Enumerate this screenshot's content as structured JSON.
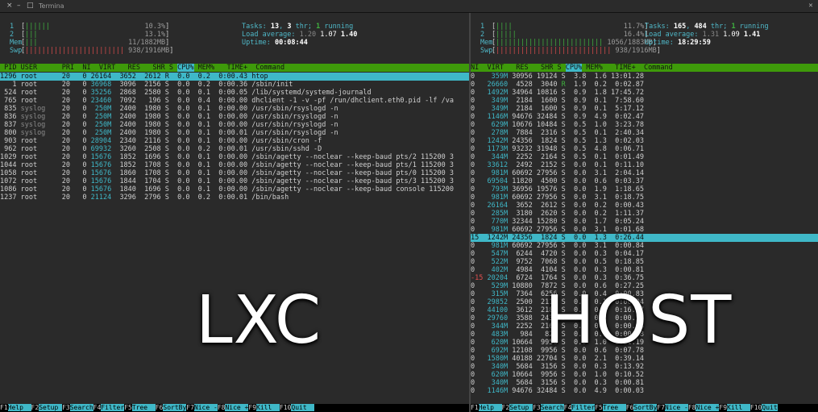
{
  "window": {
    "title": "Termina",
    "close_glyph": "×",
    "minimize_glyph": "–",
    "maximize_glyph": "□",
    "right_glyph": "✕"
  },
  "colors": {
    "accent_cyan": "#3fb8c8",
    "header_green": "#3e9a0a",
    "bar_green": "#3fb13f",
    "bar_red": "#d84a4a"
  },
  "left": {
    "meters": [
      {
        "label": "1",
        "bars": "||||||",
        "value": "10.3%"
      },
      {
        "label": "2",
        "bars": "|||",
        "value": "13.1%"
      },
      {
        "label": "Mem",
        "bars": "|||",
        "value": "11/1882MB"
      },
      {
        "label": "Swp",
        "bars": "||||||||||||||||||||||||",
        "value": "938/1916MB"
      }
    ],
    "tasks_label": "Tasks: ",
    "tasks": "13",
    "tasks_sep": ", ",
    "thr": "3",
    "thr_label": " thr; ",
    "running": "1",
    "running_label": " running",
    "load_label": "Load average: ",
    "load1": "1.20",
    "load5": "1.07",
    "load15": "1.40",
    "uptime_label": "Uptime: ",
    "uptime": "00:08:44",
    "header": {
      "pre": " PID USER      PRI  NI  VIRT   RES   SHR S ",
      "sel": "CPU%",
      "post": " MEM%   TIME+  Command"
    },
    "rows": [
      {
        "pid": "1296",
        "user": "root",
        "pri": "20",
        "ni": "0",
        "virt": "26164",
        "res": "3652",
        "shr": "2612",
        "s": "R",
        "cpu": "0.0",
        "mem": "0.2",
        "time": "0:00.43",
        "cmd": "htop"
      },
      {
        "pid": "1",
        "user": "root",
        "pri": "20",
        "ni": "0",
        "virt": "36968",
        "res": "3096",
        "shr": "2156",
        "s": "S",
        "cpu": "0.0",
        "mem": "0.2",
        "time": "0:00.36",
        "cmd": "/sbin/init"
      },
      {
        "pid": "524",
        "user": "root",
        "pri": "20",
        "ni": "0",
        "virt": "35256",
        "res": "2868",
        "shr": "2580",
        "s": "S",
        "cpu": "0.0",
        "mem": "0.1",
        "time": "0:00.05",
        "cmd": "/lib/systemd/systemd-journald"
      },
      {
        "pid": "765",
        "user": "root",
        "pri": "20",
        "ni": "0",
        "virt": "23460",
        "res": "7092",
        "shr": "196",
        "s": "S",
        "cpu": "0.0",
        "mem": "0.4",
        "time": "0:00.00",
        "cmd": "dhclient -1 -v -pf /run/dhclient.eth0.pid -lf /va"
      },
      {
        "pid": "835",
        "user": "syslog",
        "pri": "20",
        "ni": "0",
        "virt": "250M",
        "res": "2400",
        "shr": "1980",
        "s": "S",
        "cpu": "0.0",
        "mem": "0.1",
        "time": "0:00.00",
        "cmd": "/usr/sbin/rsyslogd -n"
      },
      {
        "pid": "836",
        "user": "syslog",
        "pri": "20",
        "ni": "0",
        "virt": "250M",
        "res": "2400",
        "shr": "1980",
        "s": "S",
        "cpu": "0.0",
        "mem": "0.1",
        "time": "0:00.00",
        "cmd": "/usr/sbin/rsyslogd -n"
      },
      {
        "pid": "837",
        "user": "syslog",
        "pri": "20",
        "ni": "0",
        "virt": "250M",
        "res": "2400",
        "shr": "1980",
        "s": "S",
        "cpu": "0.0",
        "mem": "0.1",
        "time": "0:00.00",
        "cmd": "/usr/sbin/rsyslogd -n"
      },
      {
        "pid": "800",
        "user": "syslog",
        "pri": "20",
        "ni": "0",
        "virt": "250M",
        "res": "2400",
        "shr": "1980",
        "s": "S",
        "cpu": "0.0",
        "mem": "0.1",
        "time": "0:00.01",
        "cmd": "/usr/sbin/rsyslogd -n"
      },
      {
        "pid": "903",
        "user": "root",
        "pri": "20",
        "ni": "0",
        "virt": "28904",
        "res": "2340",
        "shr": "2116",
        "s": "S",
        "cpu": "0.0",
        "mem": "0.1",
        "time": "0:00.00",
        "cmd": "/usr/sbin/cron -f"
      },
      {
        "pid": "962",
        "user": "root",
        "pri": "20",
        "ni": "0",
        "virt": "69932",
        "res": "3260",
        "shr": "2508",
        "s": "S",
        "cpu": "0.0",
        "mem": "0.2",
        "time": "0:00.01",
        "cmd": "/usr/sbin/sshd -D"
      },
      {
        "pid": "1029",
        "user": "root",
        "pri": "20",
        "ni": "0",
        "virt": "15676",
        "res": "1852",
        "shr": "1696",
        "s": "S",
        "cpu": "0.0",
        "mem": "0.1",
        "time": "0:00.00",
        "cmd": "/sbin/agetty --noclear --keep-baud pts/2 115200 3"
      },
      {
        "pid": "1044",
        "user": "root",
        "pri": "20",
        "ni": "0",
        "virt": "15676",
        "res": "1852",
        "shr": "1708",
        "s": "S",
        "cpu": "0.0",
        "mem": "0.1",
        "time": "0:00.00",
        "cmd": "/sbin/agetty --noclear --keep-baud pts/1 115200 3"
      },
      {
        "pid": "1058",
        "user": "root",
        "pri": "20",
        "ni": "0",
        "virt": "15676",
        "res": "1860",
        "shr": "1708",
        "s": "S",
        "cpu": "0.0",
        "mem": "0.1",
        "time": "0:00.00",
        "cmd": "/sbin/agetty --noclear --keep-baud pts/0 115200 3"
      },
      {
        "pid": "1072",
        "user": "root",
        "pri": "20",
        "ni": "0",
        "virt": "15676",
        "res": "1844",
        "shr": "1704",
        "s": "S",
        "cpu": "0.0",
        "mem": "0.1",
        "time": "0:00.00",
        "cmd": "/sbin/agetty --noclear --keep-baud pts/3 115200 3"
      },
      {
        "pid": "1086",
        "user": "root",
        "pri": "20",
        "ni": "0",
        "virt": "15676",
        "res": "1840",
        "shr": "1696",
        "s": "S",
        "cpu": "0.0",
        "mem": "0.1",
        "time": "0:00.00",
        "cmd": "/sbin/agetty --noclear --keep-baud console 115200"
      },
      {
        "pid": "1237",
        "user": "root",
        "pri": "20",
        "ni": "0",
        "virt": "21124",
        "res": "3296",
        "shr": "2796",
        "s": "S",
        "cpu": "0.0",
        "mem": "0.2",
        "time": "0:00.01",
        "cmd": "/bin/bash"
      }
    ],
    "fkeys": [
      {
        "k": "F1",
        "l": "Help  "
      },
      {
        "k": "F2",
        "l": "Setup "
      },
      {
        "k": "F3",
        "l": "Search"
      },
      {
        "k": "F4",
        "l": "Filter"
      },
      {
        "k": "F5",
        "l": "Tree  "
      },
      {
        "k": "F6",
        "l": "SortBy"
      },
      {
        "k": "F7",
        "l": "Nice -"
      },
      {
        "k": "F8",
        "l": "Nice +"
      },
      {
        "k": "F9",
        "l": "Kill  "
      },
      {
        "k": "F10",
        "l": "Quit  "
      }
    ]
  },
  "right": {
    "meters": [
      {
        "label": "1",
        "bars": "||||",
        "value": "11.7%"
      },
      {
        "label": "2",
        "bars": "|||||",
        "value": "16.4%"
      },
      {
        "label": "Mem",
        "bars": "||||||||||||||||||||||||||",
        "value": "1056/1883MB"
      },
      {
        "label": "Swp",
        "bars": "||||||||||||||||||||||||||||",
        "value": "938/1916MB"
      }
    ],
    "tasks_label": "Tasks: ",
    "tasks": "165",
    "tasks_sep": ", ",
    "thr": "484",
    "thr_label": " thr; ",
    "running": "1",
    "running_label": " running",
    "load_label": "Load average: ",
    "load1": "1.31",
    "load5": "1.09",
    "load15": "1.41",
    "uptime_label": "Uptime: ",
    "uptime": "18:29:59",
    "header": {
      "pre": "NI  VIRT   RES   SHR S ",
      "sel": "CPU%",
      "post": " MEM%   TIME+  Command"
    },
    "rows": [
      {
        "ni": "0",
        "virt": "359M",
        "res": "30956",
        "shr": "19124",
        "s": "S",
        "cpu": "3.8",
        "mem": "1.6",
        "time": "13:01.28"
      },
      {
        "ni": "0",
        "virt": "26660",
        "res": "4528",
        "shr": "3040",
        "s": "R",
        "cpu": "1.9",
        "mem": "0.2",
        "time": "0:02.87"
      },
      {
        "ni": "0",
        "virt": "1492M",
        "res": "34964",
        "shr": "10816",
        "s": "S",
        "cpu": "0.9",
        "mem": "1.8",
        "time": "17:45.72"
      },
      {
        "ni": "0",
        "virt": "349M",
        "res": "2184",
        "shr": "1600",
        "s": "S",
        "cpu": "0.9",
        "mem": "0.1",
        "time": "7:58.60"
      },
      {
        "ni": "0",
        "virt": "349M",
        "res": "2184",
        "shr": "1600",
        "s": "S",
        "cpu": "0.9",
        "mem": "0.1",
        "time": "5:17.12"
      },
      {
        "ni": "0",
        "virt": "1146M",
        "res": "94676",
        "shr": "32484",
        "s": "S",
        "cpu": "0.9",
        "mem": "4.9",
        "time": "0:02.47"
      },
      {
        "ni": "0",
        "virt": "629M",
        "res": "10676",
        "shr": "10484",
        "s": "S",
        "cpu": "0.5",
        "mem": "1.0",
        "time": "3:23.78"
      },
      {
        "ni": "0",
        "virt": "278M",
        "res": "7884",
        "shr": "2316",
        "s": "S",
        "cpu": "0.5",
        "mem": "0.1",
        "time": "2:40.34"
      },
      {
        "ni": "0",
        "virt": "1242M",
        "res": "24356",
        "shr": "1824",
        "s": "S",
        "cpu": "0.5",
        "mem": "1.3",
        "time": "0:02.03"
      },
      {
        "ni": "0",
        "virt": "1173M",
        "res": "93232",
        "shr": "31948",
        "s": "S",
        "cpu": "0.5",
        "mem": "4.8",
        "time": "0:06.71"
      },
      {
        "ni": "0",
        "virt": "344M",
        "res": "2252",
        "shr": "2164",
        "s": "S",
        "cpu": "0.5",
        "mem": "0.1",
        "time": "0:01.49"
      },
      {
        "ni": "0",
        "virt": "33612",
        "res": "2492",
        "shr": "2152",
        "s": "S",
        "cpu": "0.0",
        "mem": "0.1",
        "time": "0:11.10"
      },
      {
        "ni": "0",
        "virt": "981M",
        "res": "60692",
        "shr": "27956",
        "s": "S",
        "cpu": "0.0",
        "mem": "3.1",
        "time": "2:04.14"
      },
      {
        "ni": "0",
        "virt": "69504",
        "res": "11820",
        "shr": "4500",
        "s": "S",
        "cpu": "0.0",
        "mem": "0.6",
        "time": "0:03.37"
      },
      {
        "ni": "0",
        "virt": "793M",
        "res": "36956",
        "shr": "19576",
        "s": "S",
        "cpu": "0.0",
        "mem": "1.9",
        "time": "1:18.65"
      },
      {
        "ni": "0",
        "virt": "981M",
        "res": "60692",
        "shr": "27956",
        "s": "S",
        "cpu": "0.0",
        "mem": "3.1",
        "time": "0:18.75"
      },
      {
        "ni": "0",
        "virt": "26164",
        "res": "3652",
        "shr": "2612",
        "s": "S",
        "cpu": "0.0",
        "mem": "0.2",
        "time": "0:00.43"
      },
      {
        "ni": "0",
        "virt": "285M",
        "res": "3180",
        "shr": "2620",
        "s": "S",
        "cpu": "0.0",
        "mem": "0.2",
        "time": "1:11.37"
      },
      {
        "ni": "0",
        "virt": "770M",
        "res": "32344",
        "shr": "15280",
        "s": "S",
        "cpu": "0.0",
        "mem": "1.7",
        "time": "0:05.24"
      },
      {
        "ni": "0",
        "virt": "981M",
        "res": "60692",
        "shr": "27956",
        "s": "S",
        "cpu": "0.0",
        "mem": "3.1",
        "time": "0:01.68"
      },
      {
        "ni": "15",
        "virt": "1242M",
        "res": "24356",
        "shr": "1824",
        "s": "S",
        "cpu": "0.0",
        "mem": "1.3",
        "time": "0:26.44",
        "sel": true
      },
      {
        "ni": "0",
        "virt": "981M",
        "res": "60692",
        "shr": "27956",
        "s": "S",
        "cpu": "0.0",
        "mem": "3.1",
        "time": "0:00.84"
      },
      {
        "ni": "0",
        "virt": "547M",
        "res": "6244",
        "shr": "4720",
        "s": "S",
        "cpu": "0.0",
        "mem": "0.3",
        "time": "0:04.17"
      },
      {
        "ni": "0",
        "virt": "522M",
        "res": "9752",
        "shr": "7068",
        "s": "S",
        "cpu": "0.0",
        "mem": "0.5",
        "time": "0:18.85"
      },
      {
        "ni": "0",
        "virt": "402M",
        "res": "4984",
        "shr": "4104",
        "s": "S",
        "cpu": "0.0",
        "mem": "0.3",
        "time": "0:00.81"
      },
      {
        "ni": "-15",
        "virt": "20204",
        "res": "6724",
        "shr": "1764",
        "s": "S",
        "cpu": "0.0",
        "mem": "0.3",
        "time": "0:36.75"
      },
      {
        "ni": "0",
        "virt": "529M",
        "res": "10880",
        "shr": "7872",
        "s": "S",
        "cpu": "0.0",
        "mem": "0.6",
        "time": "0:27.25"
      },
      {
        "ni": "0",
        "virt": "315M",
        "res": "7364",
        "shr": "6256",
        "s": "S",
        "cpu": "0.0",
        "mem": "0.4",
        "time": "0:00.83"
      },
      {
        "ni": "0",
        "virt": "29852",
        "res": "2500",
        "shr": "2116",
        "s": "S",
        "cpu": "0.0",
        "mem": "0.1",
        "time": "0:00.04"
      },
      {
        "ni": "0",
        "virt": "44100",
        "res": "3612",
        "shr": "2188",
        "s": "S",
        "cpu": "0.0",
        "mem": "0.2",
        "time": "0:16.17"
      },
      {
        "ni": "0",
        "virt": "29760",
        "res": "3588",
        "shr": "2432",
        "s": "S",
        "cpu": "0.0",
        "mem": "0.2",
        "time": "0:00.18"
      },
      {
        "ni": "0",
        "virt": "344M",
        "res": "2252",
        "shr": "2164",
        "s": "S",
        "cpu": "0.0",
        "mem": "0.1",
        "time": "0:00.03"
      },
      {
        "ni": "0",
        "virt": "483M",
        "res": "984",
        "shr": "820",
        "s": "S",
        "cpu": "0.0",
        "mem": "0.1",
        "time": "0:00.08"
      },
      {
        "ni": "0",
        "virt": "620M",
        "res": "10664",
        "shr": "9956",
        "s": "S",
        "cpu": "0.0",
        "mem": "1.0",
        "time": "0:31.19"
      },
      {
        "ni": "0",
        "virt": "692M",
        "res": "12108",
        "shr": "9956",
        "s": "S",
        "cpu": "0.0",
        "mem": "0.6",
        "time": "0:07.78"
      },
      {
        "ni": "0",
        "virt": "1580M",
        "res": "40188",
        "shr": "22704",
        "s": "S",
        "cpu": "0.0",
        "mem": "2.1",
        "time": "0:39.14"
      },
      {
        "ni": "0",
        "virt": "340M",
        "res": "5684",
        "shr": "3156",
        "s": "S",
        "cpu": "0.0",
        "mem": "0.3",
        "time": "0:13.92"
      },
      {
        "ni": "0",
        "virt": "620M",
        "res": "10664",
        "shr": "9956",
        "s": "S",
        "cpu": "0.0",
        "mem": "1.0",
        "time": "0:10.52"
      },
      {
        "ni": "0",
        "virt": "340M",
        "res": "5684",
        "shr": "3156",
        "s": "S",
        "cpu": "0.0",
        "mem": "0.3",
        "time": "0:00.81"
      },
      {
        "ni": "0",
        "virt": "1146M",
        "res": "94676",
        "shr": "32484",
        "s": "S",
        "cpu": "0.0",
        "mem": "4.9",
        "time": "0:00.03"
      }
    ],
    "fkeys": [
      {
        "k": "F1",
        "l": "Help  "
      },
      {
        "k": "F2",
        "l": "Setup "
      },
      {
        "k": "F3",
        "l": "Search"
      },
      {
        "k": "F4",
        "l": "Filter"
      },
      {
        "k": "F5",
        "l": "Tree  "
      },
      {
        "k": "F6",
        "l": "SortBy"
      },
      {
        "k": "F7",
        "l": "Nice -"
      },
      {
        "k": "F8",
        "l": "Nice +"
      },
      {
        "k": "F9",
        "l": "Kill  "
      },
      {
        "k": "F10",
        "l": "Quit"
      }
    ]
  },
  "overlay": {
    "left_label": "LXC",
    "right_label": "HOST"
  }
}
